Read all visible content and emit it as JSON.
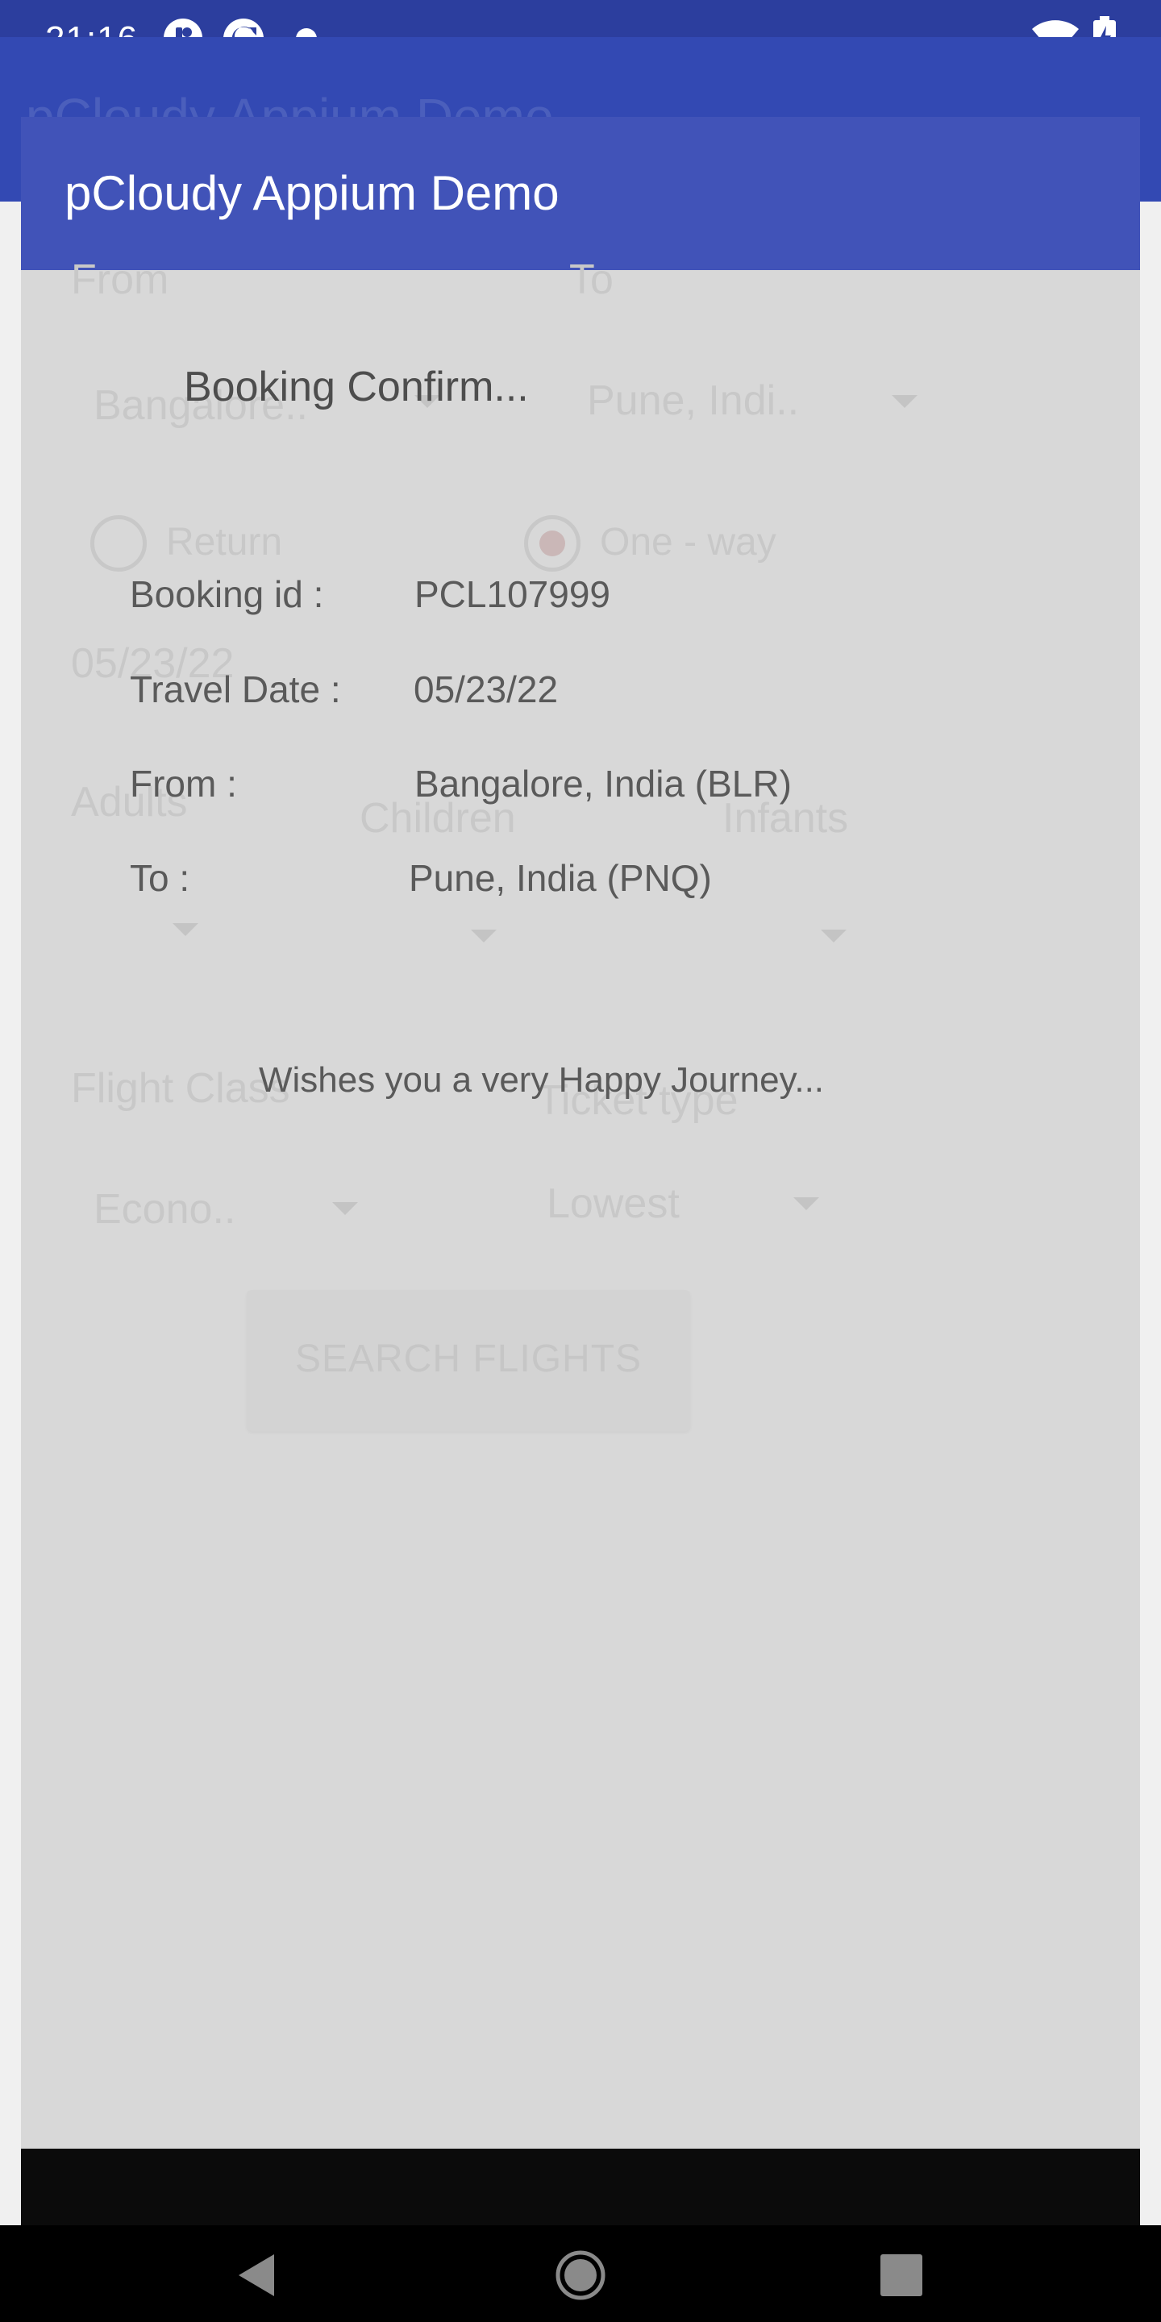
{
  "status_bar": {
    "time": "21:16",
    "icons_left": [
      "app-notification-icon",
      "sync-notification-icon",
      "dot-notification-icon"
    ],
    "icons_right": [
      "wifi-icon",
      "battery-charging-icon"
    ]
  },
  "app": {
    "title": "pCloudy Appium Demo",
    "ghost_title": "pCloudy Appium Demo",
    "accent": "#4153b8",
    "status_color": "#2c3e9e"
  },
  "background_form": {
    "from_label": "From",
    "to_label": "To",
    "from_value": "Bangalore..",
    "to_value": "Pune, Indi..",
    "trip_return": "Return",
    "trip_oneway": "One - way",
    "date": "05/23/22",
    "adults": "Adults",
    "children": "Children",
    "infants": "Infants",
    "flight_class_label": "Flight Class",
    "ticket_type_label": "Ticket type",
    "flight_class_value": "Econo..",
    "ticket_type_value": "Lowest",
    "search_button": "SEARCH FLIGHTS"
  },
  "dialog": {
    "title": "Booking Confirm...",
    "booking_id_label": "Booking id :",
    "booking_id_value": "PCL107999",
    "travel_date_label": "Travel Date :",
    "travel_date_value": "05/23/22",
    "from_label": "From :",
    "from_value": "Bangalore, India (BLR)",
    "to_label": "To :",
    "to_value": "Pune, India (PNQ)",
    "wish": "Wishes you a very Happy Journey..."
  },
  "navbar": {
    "buttons": [
      "back-icon",
      "home-icon",
      "recents-icon"
    ]
  }
}
